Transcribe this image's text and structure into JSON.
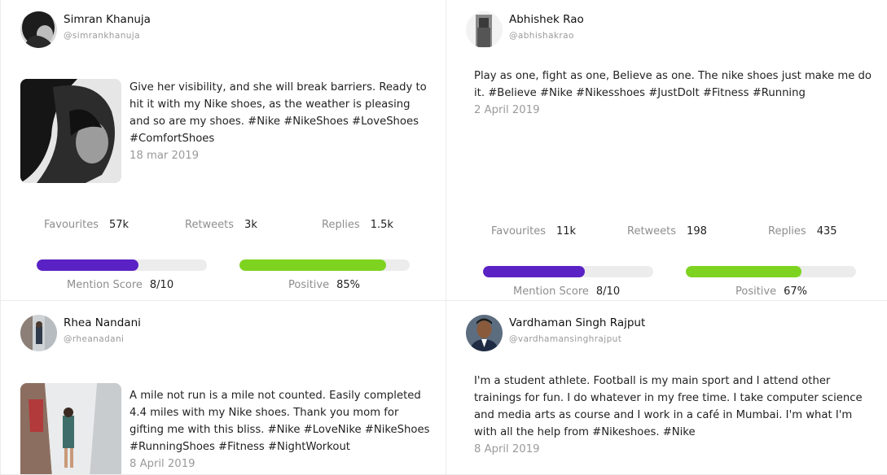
{
  "colors": {
    "mention_bar": "#5a22c4",
    "positive_bar": "#7ed321",
    "track": "#ececec"
  },
  "posts": [
    {
      "name": "Simran Khanuja",
      "handle": "@simrankhanuja",
      "text": "Give her visibility, and she will break barriers. Ready to hit it with my Nike shoes, as the weather is pleasing and so are my shoes. #Nike #NikeShoes #LoveShoes #ComfortShoes",
      "date": "18 mar 2019",
      "favourites_label": "Favourites",
      "favourites": "57k",
      "retweets_label": "Retweets",
      "retweets": "3k",
      "replies_label": "Replies",
      "replies": "1.5k",
      "mention_label": "Mention Score",
      "mention_value": "8/10",
      "mention_fraction": 0.6,
      "positive_label": "Positive",
      "positive_value": "85%",
      "positive_fraction": 0.86
    },
    {
      "name": "Abhishek Rao",
      "handle": "@abhishakrao",
      "text": "Play as one, fight as one, Believe as one. The nike shoes just make me do it. #Believe #Nike #Nikesshoes #JustDolt #Fitness #Running",
      "date": "2 April 2019",
      "favourites_label": "Favourites",
      "favourites": "11k",
      "retweets_label": "Retweets",
      "retweets": "198",
      "replies_label": "Replies",
      "replies": "435",
      "mention_label": "Mention Score",
      "mention_value": "8/10",
      "mention_fraction": 0.6,
      "positive_label": "Positive",
      "positive_value": "67%",
      "positive_fraction": 0.68
    },
    {
      "name": "Rhea Nandani",
      "handle": "@rheanadani",
      "text": "A mile not run is a mile not counted. Easily completed 4.4 miles with my Nike shoes. Thank you mom for gifting me with this bliss. #Nike #LoveNike #NikeShoes #RunningShoes #Fitness #NightWorkout",
      "date": "8 April 2019"
    },
    {
      "name": "Vardhaman Singh Rajput",
      "handle": "@vardhamansinghrajput",
      "text": "I'm a student athlete. Football is my main sport and I attend other trainings for fun. I do whatever in my free time. I take computer science and media arts as course and I work in a café in Mumbai. I'm what I'm with all the help from #Nikeshoes. #Nike",
      "date": "8 April 2019"
    }
  ]
}
